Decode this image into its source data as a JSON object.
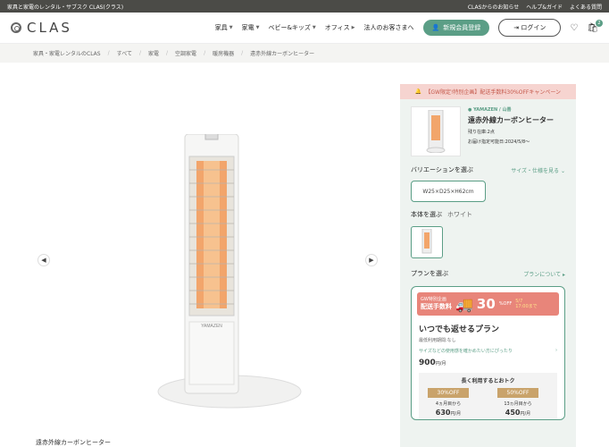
{
  "topbar": {
    "text": "家具と家電のレンタル・サブスク CLAS(クラス)",
    "links": [
      "CLASからのお知らせ",
      "ヘルプ&ガイド",
      "よくある質問"
    ]
  },
  "header": {
    "logo": "CLAS",
    "nav": [
      "家具",
      "家電",
      "ベビー&キッズ",
      "オフィス"
    ],
    "corporate": "法人のお客さまへ",
    "register": "新規会員登録",
    "login": "ログイン",
    "cart_count": "2"
  },
  "breadcrumb": [
    "家具・家電レンタルのCLAS",
    "すべて",
    "家電",
    "空調家電",
    "暖房機器",
    "遠赤外線カーボンヒーター"
  ],
  "product": {
    "caption": "遠赤外線カーボンヒーター",
    "label_text": "YAMAZEN"
  },
  "panel": {
    "promo": "【GW限定!特別企画】配送手数料30%OFFキャンペーン",
    "brand": "YAMAZEN / 山善",
    "name": "遠赤外線カーボンヒーター",
    "stock": "残り在庫:2点",
    "delivery": "お届け指定可能日:2024/5/8〜",
    "variation_label": "バリエーションを選ぶ",
    "size_link": "サイズ・仕様を見る",
    "variation": "W25×D25×H62cm",
    "color_label": "本体を選ぶ",
    "color_value": "ホワイト",
    "plan_label": "プランを選ぶ",
    "plan_link": "プランについて",
    "campaign_top": "GW特別企画",
    "campaign_main": "配送手数料",
    "campaign_pct": "30",
    "campaign_pct_suffix": "%OFF",
    "campaign_date1": "5/7",
    "campaign_date2": "17:00まで",
    "plan_title": "いつでも返せるプラン",
    "plan_min": "最低利用期間:なし",
    "plan_note": "サイズなどの使用感を確かめたい方にぴったり",
    "plan_price": "900",
    "plan_price_unit": "円/月",
    "deals_head": "長く利用するとおトク",
    "deal1_off": "30%OFF",
    "deal1_txt": "4ヵ月目から",
    "deal1_price": "630",
    "deal1_unit": "円/月",
    "deal2_off": "50%OFF",
    "deal2_txt": "13ヵ月目から",
    "deal2_price": "450",
    "deal2_unit": "円/月"
  },
  "colors": {
    "accent": "#5b9e86",
    "promo_bg": "#f6d4d0",
    "campaign": "#e8857a"
  }
}
